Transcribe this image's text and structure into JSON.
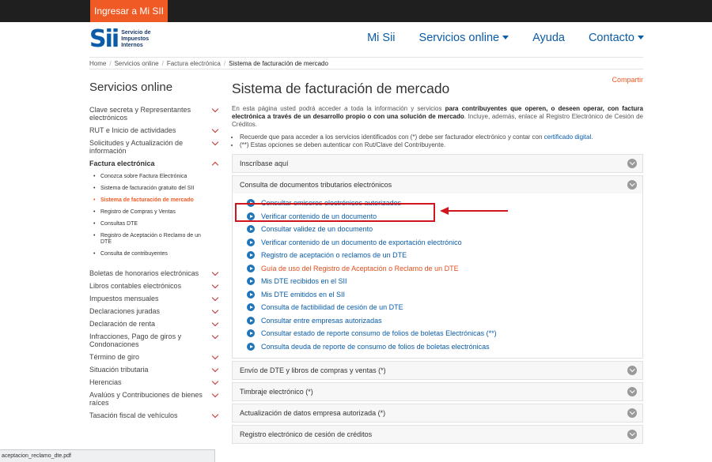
{
  "topbar": {
    "login_label": "Ingresar a Mi SII"
  },
  "logo": {
    "mark": "Sii",
    "text_line1": "Servicio de",
    "text_line2": "Impuestos",
    "text_line3": "Internos"
  },
  "nav": {
    "mi_sii": "Mi Sii",
    "servicios": "Servicios online",
    "ayuda": "Ayuda",
    "contacto": "Contacto"
  },
  "breadcrumb": {
    "home": "Home",
    "servicios": "Servicios online",
    "factura": "Factura electrónica",
    "current": "Sistema de facturación de mercado"
  },
  "sidebar": {
    "title": "Servicios online",
    "items_top": [
      "Clave secreta y Representantes electrónicos",
      "RUT e Inicio de actividades",
      "Solicitudes y Actualización de información"
    ],
    "open_item": "Factura electrónica",
    "subitems": [
      "Conozca sobre Factura Electrónica",
      "Sistema de facturación gratuito del SII",
      "Sistema de facturación de mercado",
      "Registro de Compras y Ventas",
      "Consultas DTE",
      "Registro de Aceptación o Reclamo de un DTE",
      "Consulta de contribuyentes"
    ],
    "items_bottom": [
      "Boletas de honorarios electrónicas",
      "Libros contables electrónicos",
      "Impuestos mensuales",
      "Declaraciones juradas",
      "Declaración de renta",
      "Infracciones, Pago de giros y Condonaciones",
      "Término de giro",
      "Situación tributaria",
      "Herencias",
      "Avalúos y Contribuciones de bienes raíces",
      "Tasación fiscal de vehículos"
    ]
  },
  "main": {
    "share": "Compartir",
    "title": "Sistema de facturación de mercado",
    "intro_a": "En esta página usted podrá acceder a toda la información y servicios ",
    "intro_b": "para contribuyentes que operen, o deseen operar, con factura electrónica a través de un desarrollo propio o con una solución de mercado",
    "intro_c": ". Incluye, además, enlace al Registro Electrónico de Cesión de Créditos.",
    "note1_a": "Recuerde que para acceder a los servicios identificados con (*) debe ser facturador electrónico y contar con ",
    "note1_link": "certificado digital",
    "note1_b": ".",
    "note2": "(**) Estas opciones se deben autenticar con Rut/Clave del Contribuyente.",
    "accordion": [
      "Inscríbase aquí",
      "Consulta de documentos tributarios electrónicos",
      "Envío de DTE y libros de compras y ventas (*)",
      "Timbraje electrónico (*)",
      "Actualización de datos empresa autorizada (*)",
      "Registro electrónico de cesión de créditos"
    ],
    "links": [
      "Consultar emisores electrónicos autorizados",
      "Verificar contenido de un documento",
      "Consultar validez de un documento",
      "Verificar contenido de un documento de exportación electrónico",
      "Registro de aceptación o reclamos de un DTE",
      "Guía de uso del Registro de Aceptación o Reclamo de un DTE",
      "Mis DTE recibidos en el SII",
      "Mis DTE emitidos en el SII",
      "Consulta de factibilidad de cesión de un DTE",
      "Consultar entre empresas autorizadas",
      "Consultar estado de reporte consumo de folios de boletas Electrónicas (**)",
      "Consulta deuda de reporte de consumo de folios de boletas electrónicas"
    ]
  },
  "statusbar": {
    "text": "aceptacion_reclamo_dte.pdf"
  },
  "colors": {
    "brand_orange": "#f05a24",
    "link_blue": "#0a5ca8",
    "highlight_red": "#d0161c"
  }
}
